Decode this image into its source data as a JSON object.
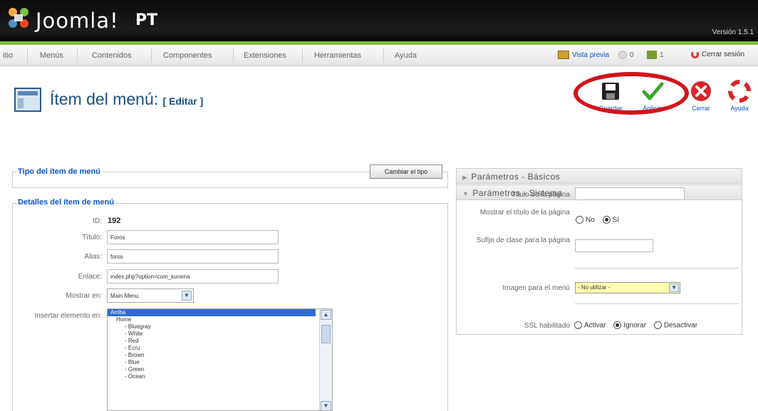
{
  "header": {
    "brand": "Joomla!",
    "brand_suffix": "PT",
    "version": "Versión 1.5.1"
  },
  "menubar": {
    "items": [
      "itio",
      "Menús",
      "Contenidos",
      "Componentes",
      "Extensiones",
      "Herramientas",
      "Ayuda"
    ],
    "preview": "Vista previa",
    "messages_count": "0",
    "users_count": "1",
    "logout": "Cerrar sesión"
  },
  "title": {
    "main": "Ítem del menú:",
    "sub": "[ Editar ]"
  },
  "toolbar": {
    "save": "Guardar",
    "apply": "Aplicar",
    "close": "Cerrar",
    "help": "Ayuda"
  },
  "type_section": {
    "legend": "Tipo del ítem de menú",
    "change_button": "Cambiar el tipo"
  },
  "details": {
    "legend": "Detalles del ítem de menú",
    "id_label": "ID:",
    "id_value": "192",
    "title_label": "Título:",
    "title_value": "Foros",
    "alias_label": "Alias:",
    "alias_value": "foros",
    "link_label": "Enlace:",
    "link_value": "index.php?option=com_kunena",
    "show_in_label": "Mostrar en:",
    "show_in_value": "Main Menu",
    "insert_label": "Insertar elemento en:",
    "insert_options": [
      "Arriba",
      "Home",
      "- Bluegray",
      "- White",
      "- Red",
      "- Ecru",
      "- Brown",
      "- Blue",
      "- Green",
      "- Ocean"
    ]
  },
  "params": {
    "basic": "Parámetros - Básicos",
    "system": "Parámetros - Sistema",
    "page_title_label": "Título de la página",
    "show_title_label": "Mostrar el título de la página",
    "show_title_no": "No",
    "show_title_yes": "Sí",
    "class_suffix_label": "Sufijo de clase para la página",
    "menu_image_label": "Imagen para el menú",
    "menu_image_value": "- No utilizar -",
    "ssl_label": "SSL habilitado",
    "ssl_on": "Activar",
    "ssl_ignore": "Ignorar",
    "ssl_off": "Desactivar"
  }
}
